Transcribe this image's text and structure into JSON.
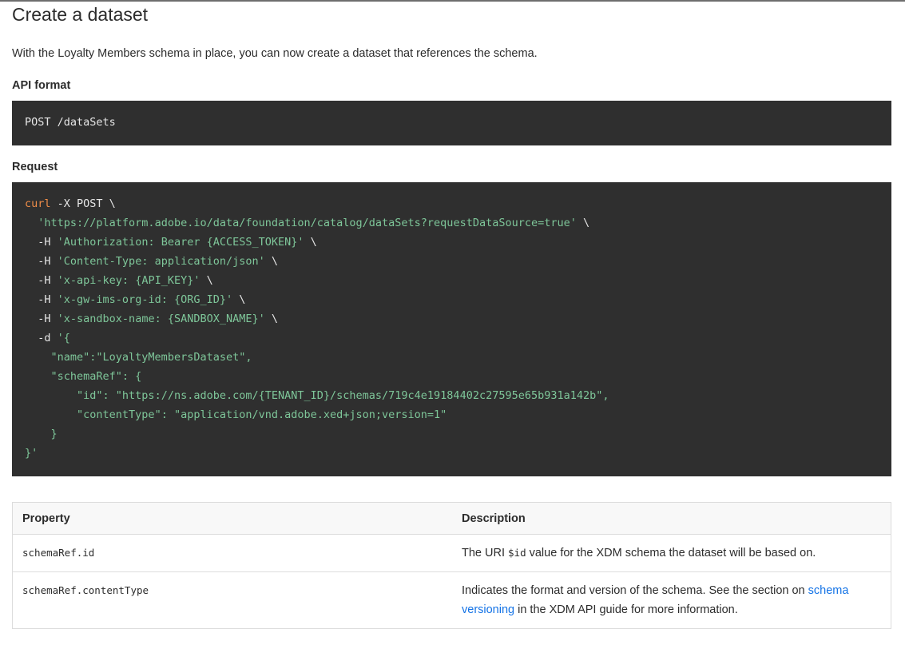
{
  "heading": "Create a dataset",
  "intro": "With the Loyalty Members schema in place, you can now create a dataset that references the schema.",
  "api_format": {
    "label": "API format",
    "code": "POST /dataSets"
  },
  "request": {
    "label": "Request",
    "lines": [
      {
        "kw": "curl",
        "rest": " -X POST \\"
      },
      {
        "indent": "  ",
        "str": "'https://platform.adobe.io/data/foundation/catalog/dataSets?requestDataSource=true'",
        "rest": " \\"
      },
      {
        "indent": "  ",
        "pre": "-H ",
        "str": "'Authorization: Bearer {ACCESS_TOKEN}'",
        "rest": " \\"
      },
      {
        "indent": "  ",
        "pre": "-H ",
        "str": "'Content-Type: application/json'",
        "rest": " \\"
      },
      {
        "indent": "  ",
        "pre": "-H ",
        "str": "'x-api-key: {API_KEY}'",
        "rest": " \\"
      },
      {
        "indent": "  ",
        "pre": "-H ",
        "str": "'x-gw-ims-org-id: {ORG_ID}'",
        "rest": " \\"
      },
      {
        "indent": "  ",
        "pre": "-H ",
        "str": "'x-sandbox-name: {SANDBOX_NAME}'",
        "rest": " \\"
      },
      {
        "indent": "  ",
        "pre": "-d ",
        "str": "'{"
      },
      {
        "indent": "    ",
        "str": "\"name\":\"LoyaltyMembersDataset\","
      },
      {
        "indent": "    ",
        "str": "\"schemaRef\": {"
      },
      {
        "indent": "        ",
        "str": "\"id\": \"https://ns.adobe.com/{TENANT_ID}/schemas/719c4e19184402c27595e65b931a142b\","
      },
      {
        "indent": "        ",
        "str": "\"contentType\": \"application/vnd.adobe.xed+json;version=1\""
      },
      {
        "indent": "    ",
        "str": "}"
      },
      {
        "str": "}'"
      }
    ]
  },
  "table": {
    "headers": [
      "Property",
      "Description"
    ],
    "rows": [
      {
        "property": "schemaRef.id",
        "desc_pre": "The URI ",
        "desc_code": "$id",
        "desc_post": " value for the XDM schema the dataset will be based on."
      },
      {
        "property": "schemaRef.contentType",
        "desc_pre": "Indicates the format and version of the schema. See the section on ",
        "desc_link": "schema versioning",
        "desc_post": " in the XDM API guide for more information."
      }
    ]
  },
  "colors": {
    "code_bg": "#2f2f2f",
    "keyword": "#f08d49",
    "string": "#7ec699",
    "link": "#1473e6"
  }
}
